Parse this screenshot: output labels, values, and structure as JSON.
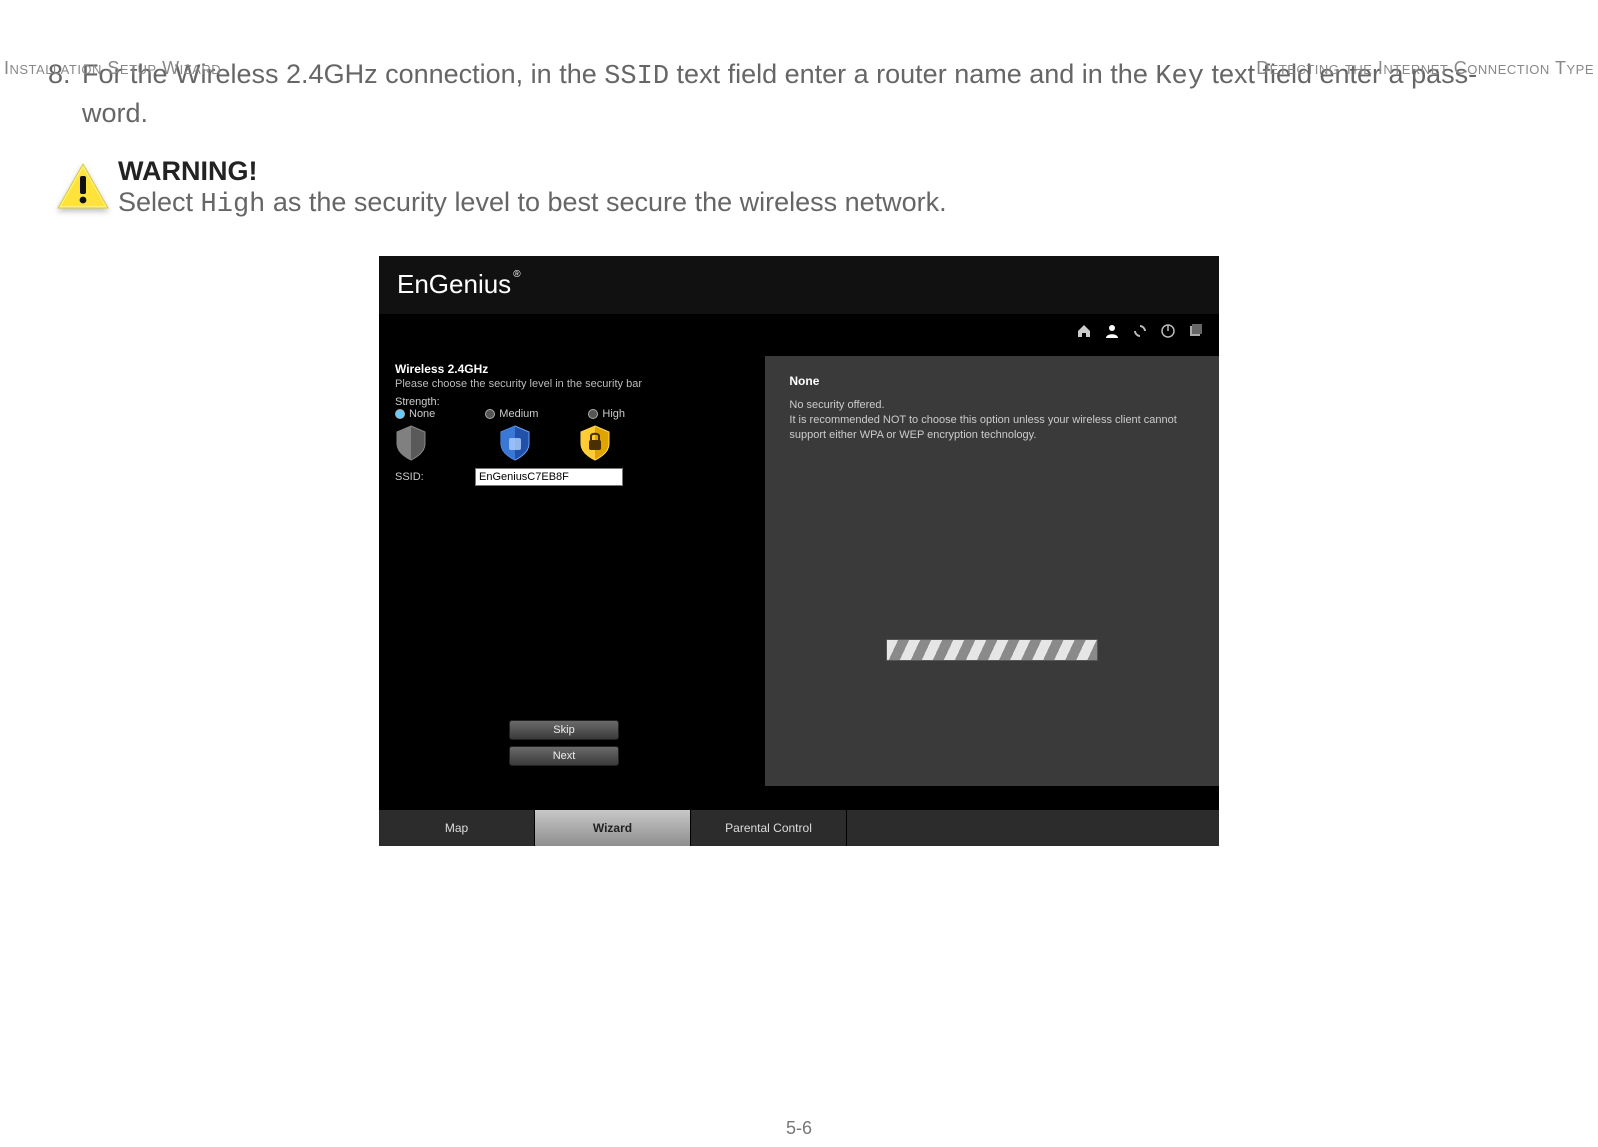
{
  "header": {
    "left": "Installation Setup Wizard",
    "right": "Detecting the Internet Connection Type"
  },
  "step": {
    "num": "8.",
    "t1": "For the Wireless 2.4GHz connection, in the ",
    "kw1": "SSID",
    "t2": " text field enter a router name and in the ",
    "kw2": "Key",
    "t3": " text field enter a pass-",
    "t4": "word."
  },
  "warning": {
    "title": "WARNING!",
    "t1": "Select ",
    "kw": "High",
    "t2": " as the security level to best secure the wireless network."
  },
  "shot": {
    "logo": "EnGenius",
    "logoReg": "®",
    "leftTitle": "Wireless 2.4GHz",
    "leftDesc": "Please choose the security level in the security bar",
    "strength": "Strength:",
    "optNone": "None",
    "optMed": "Medium",
    "optHigh": "High",
    "ssidLabel": "SSID:",
    "ssidValue": "EnGeniusC7EB8F",
    "skip": "Skip",
    "next": "Next",
    "rightTitle": "None",
    "rightP1": "No security offered.",
    "rightP2": "It is recommended NOT to choose this option unless your wireless client cannot support either WPA or WEP encryption technology."
  },
  "tabs": {
    "map": "Map",
    "wizard": "Wizard",
    "parental": "Parental Control"
  },
  "pageNum": "5-6"
}
